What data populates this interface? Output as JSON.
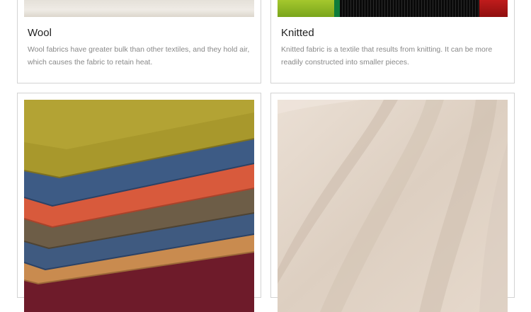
{
  "cards": {
    "wool": {
      "title": "Wool",
      "description": "Wool fabrics have greater bulk than other textiles, and they hold air, which causes the fabric to retain heat."
    },
    "knitted": {
      "title": "Knitted",
      "description": "Knitted fabric is a textile that results from knitting. It can be more readily constructed into smaller pieces."
    }
  },
  "colors": {
    "card_border": "#d3d3d3",
    "title_text": "#222222",
    "body_text": "#888888"
  }
}
